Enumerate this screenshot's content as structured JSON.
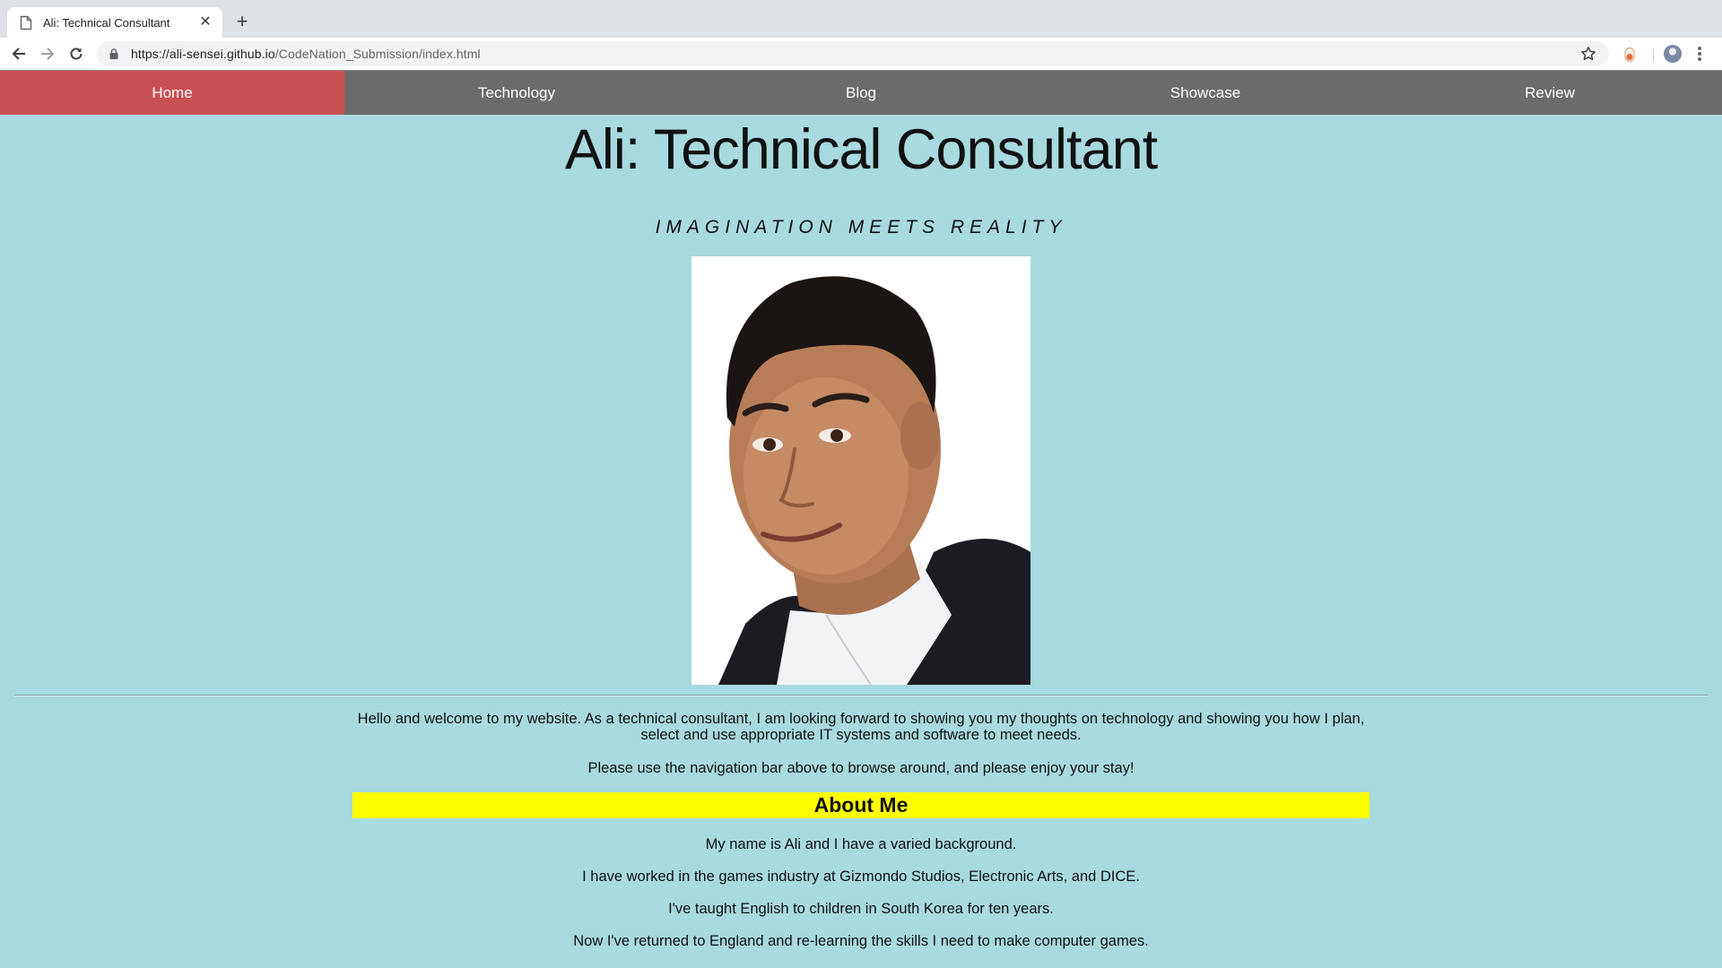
{
  "browser": {
    "tab_title": "Ali: Technical Consultant",
    "close_glyph": "✕",
    "newtab_glyph": "+",
    "url_host": "https://ali-sensei.github.io",
    "url_path": "/CodeNation_Submission/index.html"
  },
  "nav": {
    "items": [
      {
        "label": "Home"
      },
      {
        "label": "Technology"
      },
      {
        "label": "Blog"
      },
      {
        "label": "Showcase"
      },
      {
        "label": "Review"
      }
    ],
    "active_color": "#c85052",
    "bar_color": "#6b6b6b"
  },
  "page": {
    "title": "Ali: Technical Consultant",
    "tagline": "IMAGINATION MEETS REALITY",
    "intro": "Hello and welcome to my website. As a technical consultant, I am looking forward to showing you my thoughts on technology and showing you how I plan, select and use appropriate IT systems and software to meet needs.",
    "enjoy": "Please use the navigation bar above to browse around, and please enjoy your stay!",
    "about_heading": "About Me",
    "bio": [
      "My name is Ali and I have a varied background.",
      "I have worked in the games industry at Gizmondo Studios, Electronic Arts, and DICE.",
      "I've taught English to children in South Korea for ten years.",
      "Now I've returned to England and re-learning the skills I need to make computer games."
    ],
    "background_color": "#a8dadf",
    "about_highlight_color": "#ffff00"
  },
  "icons": [
    "doc-icon",
    "back-arrow-icon",
    "forward-arrow-icon",
    "reload-icon",
    "lock-icon",
    "star-icon",
    "extension-icon",
    "profile-avatar",
    "menu-kebab-icon"
  ]
}
